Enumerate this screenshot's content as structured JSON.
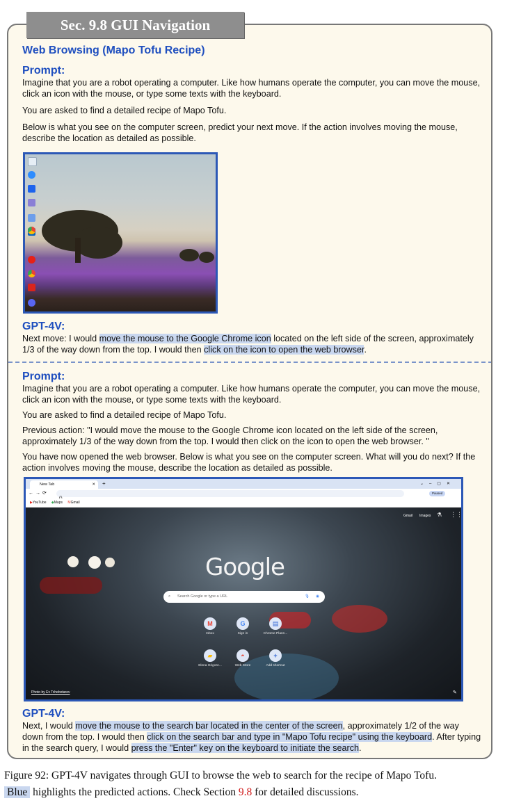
{
  "section_title": "Sec. 9.8 GUI Navigation",
  "task_title": "Web Browsing (Mapo Tofu Recipe)",
  "turn1": {
    "prompt_heading": "Prompt:",
    "p1": "Imagine that you are a robot operating a computer. Like how humans operate the computer, you can move the mouse, click an icon with the mouse, or type some texts with the keyboard.",
    "p2": "You are asked to find a detailed recipe of Mapo Tofu.",
    "p3": "Below is what you see on the computer screen, predict your next move. If the action involves moving the mouse, describe the location as detailed as possible.",
    "response_heading": "GPT-4V:",
    "r_a": "Next move: I would ",
    "r_b": "move the mouse to the Google Chrome icon",
    "r_c": " located on the left side of the screen, approximately 1/3 of the way down from the top. I would then ",
    "r_d": "click on the icon to open the web browser",
    "r_e": "."
  },
  "turn2": {
    "prompt_heading": "Prompt:",
    "p1": "Imagine that you are a robot operating a computer. Like how humans operate the computer, you can move the mouse, click an icon with the mouse, or type some texts with the keyboard.",
    "p2": "You are asked to find a detailed recipe of Mapo Tofu.",
    "p3": "Previous action: \"I would move the mouse to the Google Chrome icon located on the left side of the screen, approximately 1/3 of the way down from the top. I would then click on the icon to open the web browser. \"",
    "p4": "You have now opened the web browser. Below is what you see on the computer screen. What will you do next? If the action involves moving the mouse, describe the location as detailed as possible.",
    "response_heading": "GPT-4V:",
    "r_a": "Next, I would ",
    "r_b": "move the mouse to the search bar located in the center of the screen",
    "r_c": ", approximately 1/2 of the way down from the top. I would then ",
    "r_d": "click on the search bar and type in \"Mapo Tofu recipe\" using the keyboard",
    "r_e": ". After typing in the search query, I would ",
    "r_f": "press the \"Enter\" key on the keyboard to initiate the search",
    "r_g": "."
  },
  "desktop_screenshot": {
    "dock_labels": [
      "Recycle Bin",
      "Zoom",
      "Docker",
      "Outlook",
      "Chrome",
      "YouTube",
      "Acrobat",
      "Discord"
    ]
  },
  "chrome_screenshot": {
    "tab_label": "New Tab",
    "new_tab_plus": "+",
    "omnibox": "G",
    "profile_label": "Paused",
    "bookmarks": [
      "YouTube",
      "Maps",
      "Gmail"
    ],
    "top_links": [
      "Gmail",
      "Images"
    ],
    "logo": "Google",
    "search_placeholder": "Search Google or type a URL",
    "shortcuts": [
      "Inbox",
      "Sign in",
      "Chrome Plann...",
      "Elena Grigore...",
      "Web Store",
      "Add shortcut"
    ],
    "photo_credit": "Photo by Ev Tchebotarev"
  },
  "caption": {
    "text_a": "Figure 92: GPT-4V navigates through GUI to browse the web to search for the recipe of Mapo Tofu.",
    "blue_word": "Blue",
    "text_b": " highlights the predicted actions. Check Section ",
    "section_ref": "9.8",
    "text_c": " for detailed discussions."
  },
  "colors": {
    "heading_blue": "#1f4fbf",
    "highlight": "#c9d7ef",
    "frame_bg": "#fdf9ec",
    "title_bar": "#8e8e8e",
    "ref_red": "#d01818"
  }
}
